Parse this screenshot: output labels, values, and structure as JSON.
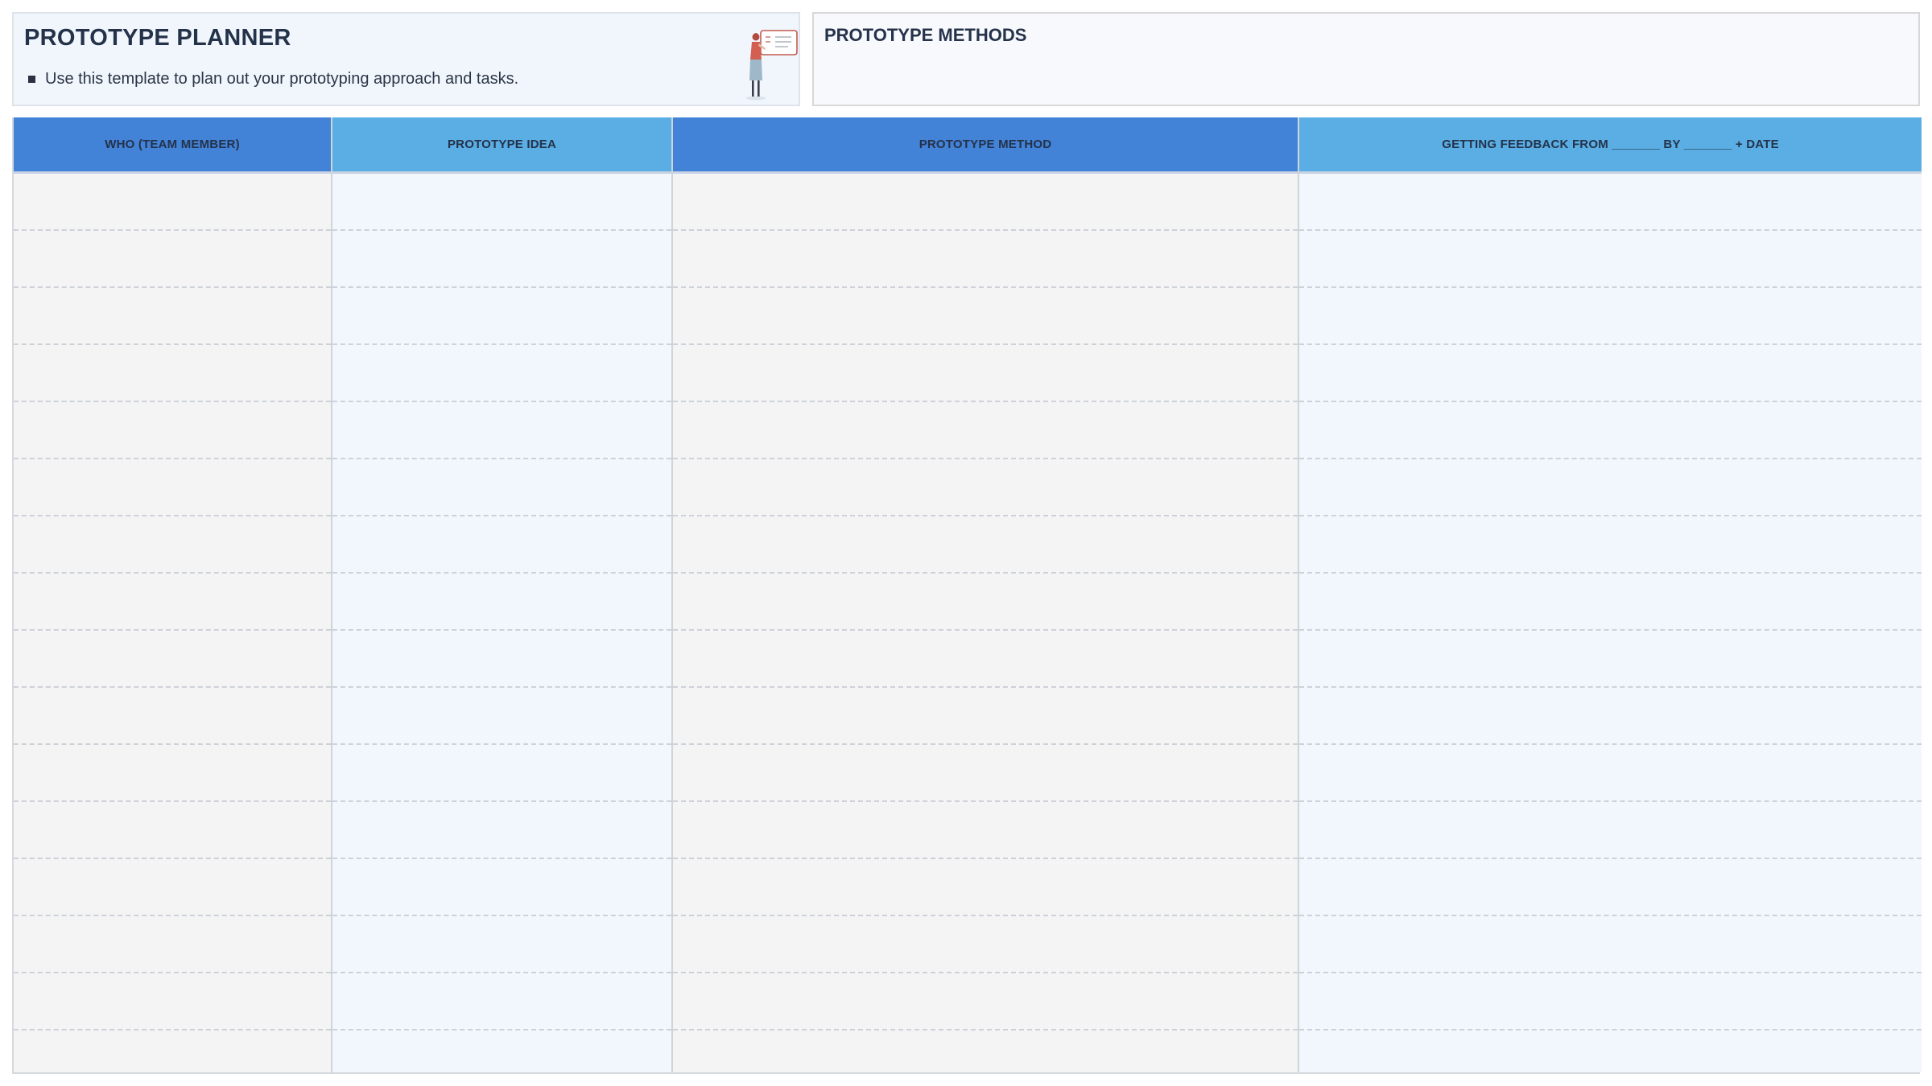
{
  "header": {
    "title": "PROTOTYPE PLANNER",
    "instruction": "Use this template to plan out your prototyping approach and tasks."
  },
  "methods_panel": {
    "title": "PROTOTYPE METHODS"
  },
  "table": {
    "columns": [
      {
        "label": "WHO (TEAM MEMBER)"
      },
      {
        "label": "PROTOTYPE IDEA"
      },
      {
        "label": "PROTOTYPE METHOD"
      },
      {
        "label": "GETTING FEEDBACK FROM _______ BY _______ + DATE"
      }
    ],
    "row_count": 16
  },
  "colors": {
    "header_dark": "#4283d8",
    "header_light": "#5aaee4",
    "cell_gray": "#f4f4f4",
    "cell_blue": "#f2f6fd",
    "title_text": "#24324a"
  },
  "icons": {
    "illustration": "person-presenting-whiteboard-illustration"
  }
}
